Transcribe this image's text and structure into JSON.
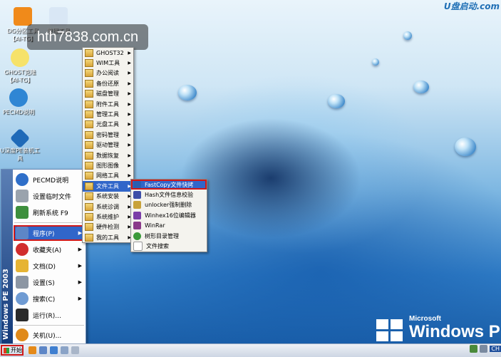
{
  "top_logo": "U盘启动.com",
  "watermark": "hth7838.com.cn",
  "desktop_icons": [
    {
      "label": "DG分区工具 【AI-TG】",
      "icon": "disk-tool-icon",
      "color": "#f08a1a"
    },
    {
      "label": "管理工具",
      "icon": "manage-tool-icon",
      "color": "#d9e7f5"
    },
    {
      "label": "GHOST克隆 【AI-TG】",
      "icon": "ghost-icon",
      "color": "#f6e26a"
    },
    {
      "label": "PECMD说明",
      "icon": "pecmd-icon",
      "color": "#2f86d4"
    },
    {
      "label": "U深度PE装机工具",
      "icon": "installer-icon",
      "color": "#1f6ab8"
    }
  ],
  "start_menu": {
    "banner": "Windows PE 2003",
    "items": [
      {
        "label": "PECMD说明",
        "icon": "help-icon",
        "color": "#2f6fc9",
        "has_submenu": false
      },
      {
        "label": "设置临时文件",
        "icon": "settings-file-icon",
        "color": "#9aa3ad",
        "has_submenu": false
      },
      {
        "label": "刷新系统 F9",
        "icon": "refresh-icon",
        "color": "#3d8f3d",
        "has_submenu": false
      },
      {
        "label": "程序(P)",
        "icon": "programs-icon",
        "color": "#5d86c7",
        "has_submenu": true
      },
      {
        "label": "收藏夹(A)",
        "icon": "favorites-icon",
        "color": "#d12d2d",
        "has_submenu": true
      },
      {
        "label": "文档(D)",
        "icon": "documents-icon",
        "color": "#e6b434",
        "has_submenu": true
      },
      {
        "label": "设置(S)",
        "icon": "settings-icon",
        "color": "#8c96a3",
        "has_submenu": true
      },
      {
        "label": "搜索(C)",
        "icon": "search-icon",
        "color": "#6f9bd3",
        "has_submenu": true
      },
      {
        "label": "运行(R)...",
        "icon": "run-icon",
        "color": "#2a2a2a",
        "has_submenu": false
      },
      {
        "label": "关机(U)...",
        "icon": "shutdown-icon",
        "color": "#e08a1a",
        "has_submenu": false
      }
    ]
  },
  "programs_menu": [
    "GHOST32",
    "WIM工具",
    "办公阅读",
    "备份还原",
    "磁盘管理",
    "附件工具",
    "管理工具",
    "光盘工具",
    "密码管理",
    "驱动管理",
    "数据恢复",
    "图形图像",
    "网络工具",
    "文件工具",
    "系统安装",
    "系统诊调",
    "系统维护",
    "硬件检测",
    "我的工具"
  ],
  "file_tools_menu": [
    {
      "label": "FastCopy文件快拷",
      "icon": "fastcopy-icon",
      "color": "#2a5fb0"
    },
    {
      "label": "Hash文件信息校验",
      "icon": "hash-icon",
      "color": "#3d4fa8"
    },
    {
      "label": "unlocker强制删除",
      "icon": "unlocker-icon",
      "color": "#c8a23a"
    },
    {
      "label": "Winhex16位编辑器",
      "icon": "winhex-icon",
      "color": "#7a3da8"
    },
    {
      "label": "WinRar",
      "icon": "winrar-icon",
      "color": "#8a3a8a"
    },
    {
      "label": "树形目录管理",
      "icon": "tree-dir-icon",
      "color": "#3a9a3a"
    },
    {
      "label": "文件搜索",
      "icon": "file-search-icon",
      "color": "#ffffff"
    }
  ],
  "win_logo": {
    "brand": "Microsoft",
    "product": "Windows PE"
  },
  "taskbar": {
    "start_label": "开始",
    "lang": "CH"
  }
}
